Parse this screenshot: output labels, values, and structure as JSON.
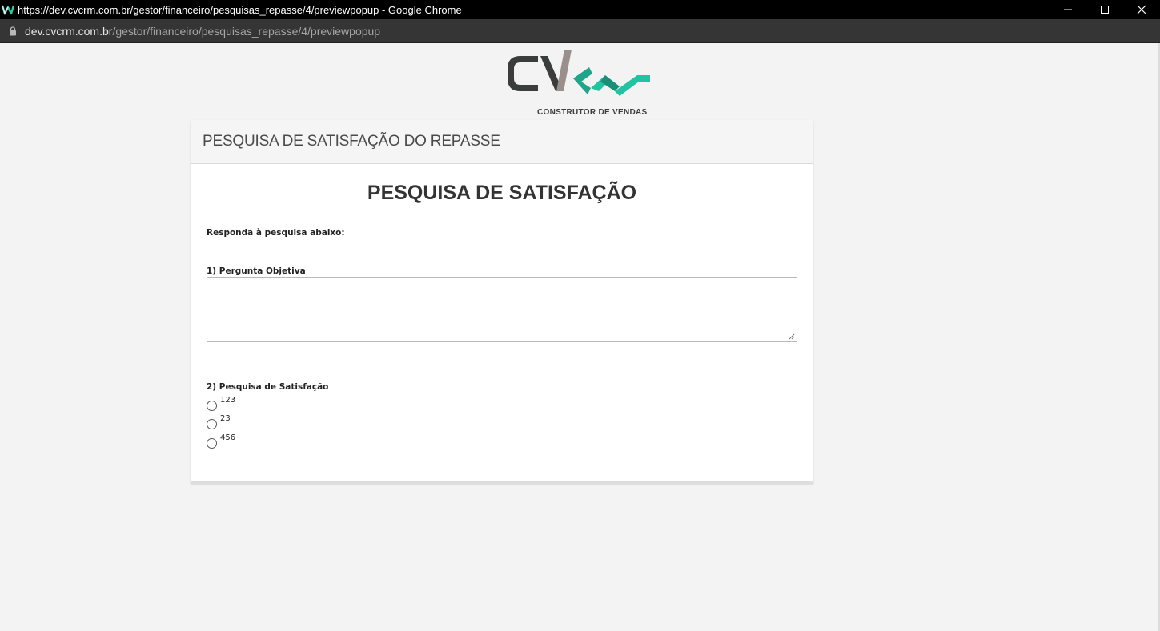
{
  "browser": {
    "window_title": "https://dev.cvcrm.com.br/gestor/financeiro/pesquisas_repasse/4/previewpopup - Google Chrome",
    "url_domain": "dev.cvcrm.com.br",
    "url_path": "/gestor/financeiro/pesquisas_repasse/4/previewpopup",
    "controls": {
      "minimize_icon": "minimize-icon",
      "maximize_icon": "maximize-icon",
      "close_icon": "close-icon"
    }
  },
  "logo": {
    "tagline": "CONSTRUTOR DE VENDAS",
    "colors": {
      "dark": "#3a3d3c",
      "mid": "#9a8f8b",
      "teal": "#1fa58a",
      "teal_light": "#22c3a0"
    }
  },
  "panel": {
    "header_title": "PESQUISA DE SATISFAÇÃO DO REPASSE",
    "survey_title": "PESQUISA DE SATISFAÇÃO",
    "intro": "Responda à pesquisa abaixo:",
    "questions": [
      {
        "label": "1) Pergunta Objetiva",
        "answer": ""
      },
      {
        "label": "2) Pesquisa de Satisfação",
        "options": [
          "123",
          "23",
          "456"
        ]
      }
    ]
  }
}
